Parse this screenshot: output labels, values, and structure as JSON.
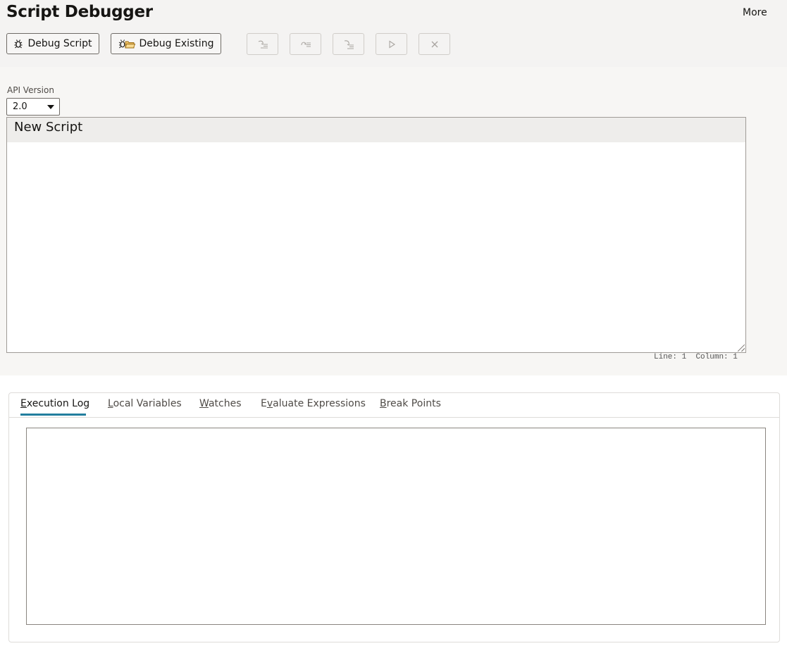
{
  "app": {
    "title": "Script Debugger",
    "more_label": "More"
  },
  "toolbar": {
    "debug_script_label": "Debug Script",
    "debug_existing_label": "Debug Existing",
    "icon_buttons": [
      "step-into-icon",
      "step-over-icon",
      "step-out-icon",
      "play-icon",
      "close-icon"
    ]
  },
  "config": {
    "api_version_label": "API Version",
    "api_version_value": "2.0"
  },
  "editor": {
    "title": "New Script",
    "content": "",
    "line_label": "Line:",
    "line_value": "1",
    "column_label": "Column:",
    "column_value": "1"
  },
  "tabs": [
    {
      "pre": "",
      "key": "E",
      "rest": "xecution Log",
      "active": true
    },
    {
      "pre": "",
      "key": "L",
      "rest": "ocal Variables",
      "active": false
    },
    {
      "pre": "",
      "key": "W",
      "rest": "atches",
      "active": false
    },
    {
      "pre": "E",
      "key": "v",
      "rest": "aluate Expressions",
      "active": false
    },
    {
      "pre": "",
      "key": "B",
      "rest": "reak Points",
      "active": false
    }
  ],
  "log": {
    "content": ""
  },
  "colors": {
    "accent": "#227e9e",
    "topbar": "#f4f3f2",
    "text": "#161513"
  }
}
